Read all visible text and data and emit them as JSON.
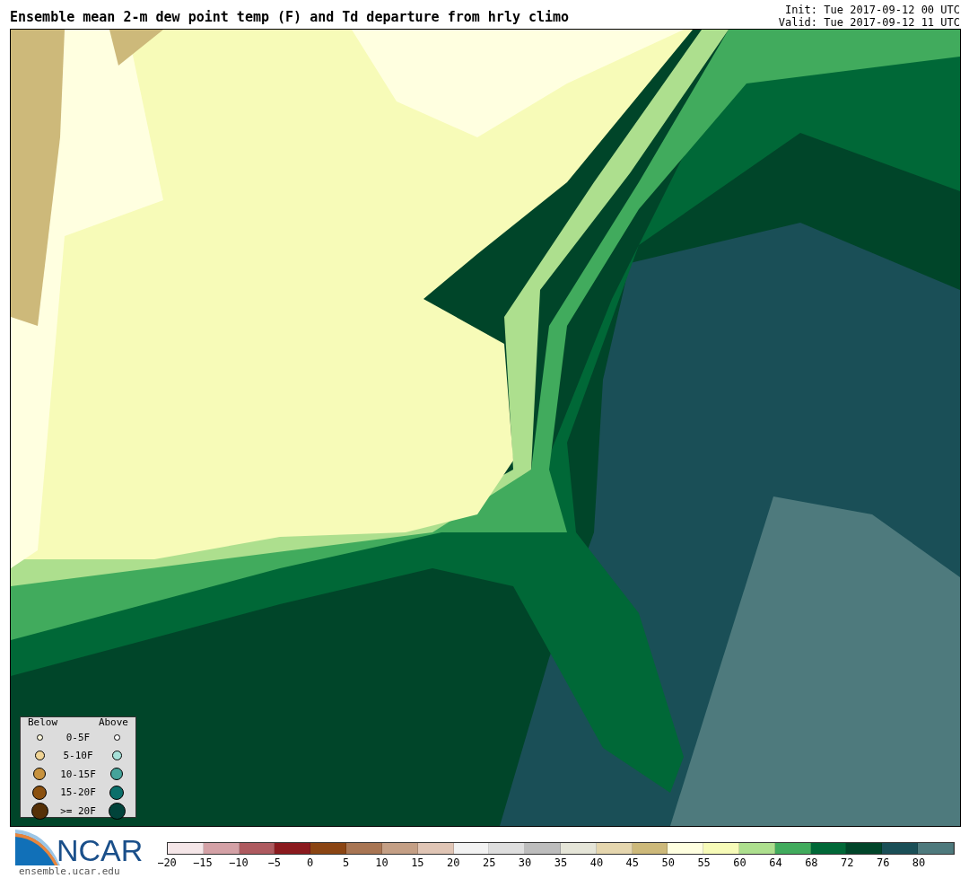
{
  "title": "Ensemble mean 2-m dew point temp (F) and Td departure from hrly climo",
  "init": "Init: Tue 2017-09-12 00 UTC",
  "valid": "Valid: Tue 2017-09-12 11 UTC",
  "legend": {
    "below_label": "Below",
    "above_label": "Above",
    "rows": [
      {
        "label": "0-5F",
        "below": {
          "color": "#fff8dc"
        },
        "above": {
          "color": "#ffffff"
        }
      },
      {
        "label": "5-10F",
        "below": {
          "color": "#f0d495"
        },
        "above": {
          "color": "#a6e0d8"
        }
      },
      {
        "label": "10-15F",
        "below": {
          "color": "#c7923e"
        },
        "above": {
          "color": "#45a39a"
        }
      },
      {
        "label": "15-20F",
        "below": {
          "color": "#8b5110"
        },
        "above": {
          "color": "#0b6f6a"
        }
      },
      {
        "label": ">= 20F",
        "below": {
          "color": "#553007"
        },
        "above": {
          "color": "#01433a"
        }
      }
    ]
  },
  "logo": {
    "name": "NCAR",
    "url": "ensemble.ucar.edu"
  },
  "colorbar": {
    "segments": [
      {
        "color": "#f5e6e8"
      },
      {
        "color": "#d4a1a6"
      },
      {
        "color": "#ae5a5f"
      },
      {
        "color": "#8b1a1e"
      },
      {
        "color": "#8b4513"
      },
      {
        "color": "#a87553"
      },
      {
        "color": "#c49f85"
      },
      {
        "color": "#e0c5b5"
      },
      {
        "color": "#f2f2f2"
      },
      {
        "color": "#dedede"
      },
      {
        "color": "#bdbdbd"
      },
      {
        "color": "#e5e5d8"
      },
      {
        "color": "#e5d6ae"
      },
      {
        "color": "#cdb97a"
      },
      {
        "color": "#ffffe0"
      },
      {
        "color": "#f7fbb8"
      },
      {
        "color": "#addf8e"
      },
      {
        "color": "#41ab5d"
      },
      {
        "color": "#006837"
      },
      {
        "color": "#004529"
      },
      {
        "color": "#1a4f57"
      },
      {
        "color": "#4e7a7d"
      }
    ],
    "ticks": [
      "−20",
      "−15",
      "−10",
      "−5",
      "0",
      "5",
      "10",
      "15",
      "20",
      "25",
      "30",
      "35",
      "40",
      "45",
      "50",
      "55",
      "60",
      "64",
      "68",
      "72",
      "76",
      "80"
    ]
  }
}
